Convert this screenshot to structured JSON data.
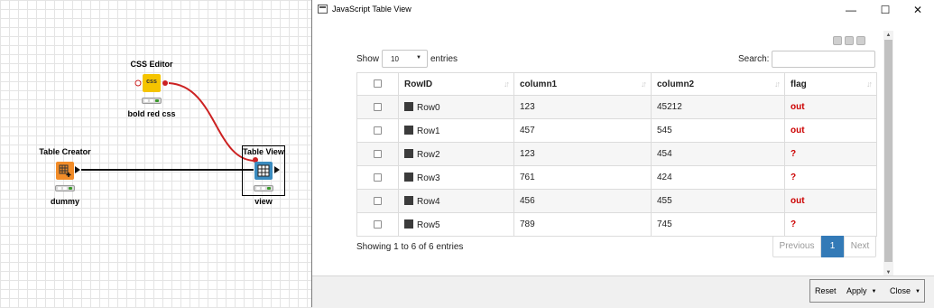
{
  "workflow": {
    "nodes": [
      {
        "title": "CSS Editor",
        "label": "bold red css",
        "icon_text": "css",
        "icon": "css-editor-icon",
        "color": "#f5c400"
      },
      {
        "title": "Table Creator",
        "label": "dummy",
        "icon": "table-creator-icon",
        "color": "#f28c28"
      },
      {
        "title": "Table View",
        "label": "view",
        "icon": "table-view-icon",
        "color": "#3a8bbf"
      }
    ],
    "colors": {
      "data_connection": "#111111",
      "style_connection": "#cc2222",
      "status_ok": "#3a9a2a"
    }
  },
  "dialog": {
    "title": "JavaScript Table View",
    "window_buttons": {
      "minimize": "—",
      "maximize": "☐",
      "close": "✕"
    },
    "show_label": "Show",
    "entries_label": "entries",
    "page_length": "10",
    "search_label": "Search:",
    "search_value": "",
    "columns": [
      "RowID",
      "column1",
      "column2",
      "flag"
    ],
    "rows": [
      {
        "id": "Row0",
        "column1": "123",
        "column2": "45212",
        "flag": "out"
      },
      {
        "id": "Row1",
        "column1": "457",
        "column2": "545",
        "flag": "out"
      },
      {
        "id": "Row2",
        "column1": "123",
        "column2": "454",
        "flag": "?"
      },
      {
        "id": "Row3",
        "column1": "761",
        "column2": "424",
        "flag": "?"
      },
      {
        "id": "Row4",
        "column1": "456",
        "column2": "455",
        "flag": "out"
      },
      {
        "id": "Row5",
        "column1": "789",
        "column2": "745",
        "flag": "?"
      }
    ],
    "info": "Showing 1 to 6 of 6 entries",
    "pagination": {
      "previous": "Previous",
      "current": "1",
      "next": "Next"
    },
    "footer": {
      "reset": "Reset",
      "apply": "Apply",
      "close": "Close"
    },
    "colors": {
      "accent": "#337ab7",
      "flag_text": "#cc0000"
    }
  }
}
